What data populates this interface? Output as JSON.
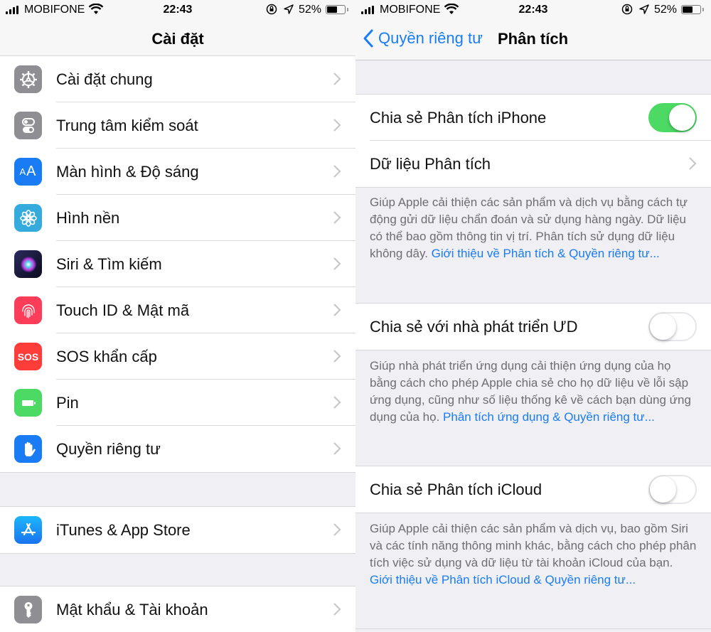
{
  "status_bar": {
    "carrier": "MOBIFONE",
    "time": "22:43",
    "battery_percent_label": "52%",
    "battery_level": 0.52
  },
  "left": {
    "title": "Cài đặt",
    "groups": [
      {
        "items": [
          {
            "label": "Cài đặt chung",
            "icon": "gear-icon",
            "color": "#8e8e93"
          },
          {
            "label": "Trung tâm kiểm soát",
            "icon": "control-center-icon",
            "color": "#8e8e93"
          },
          {
            "label": "Màn hình & Độ sáng",
            "icon": "display-brightness-icon",
            "color": "#1a7cf5"
          },
          {
            "label": "Hình nền",
            "icon": "wallpaper-flower-icon",
            "color": "#35aadc"
          },
          {
            "label": "Siri & Tìm kiếm",
            "icon": "siri-icon",
            "color": "#1c1c3c"
          },
          {
            "label": "Touch ID & Mật mã",
            "icon": "fingerprint-icon",
            "color": "#fc3d59"
          },
          {
            "label": "SOS khẩn cấp",
            "icon": "sos-icon",
            "color": "#fc3d39",
            "icon_text": "SOS"
          },
          {
            "label": "Pin",
            "icon": "battery-icon",
            "color": "#4cd964"
          },
          {
            "label": "Quyền riêng tư",
            "icon": "hand-privacy-icon",
            "color": "#1a7cf5"
          }
        ]
      },
      {
        "items": [
          {
            "label": "iTunes & App Store",
            "icon": "app-store-icon",
            "color": "#1f9bfb"
          }
        ]
      },
      {
        "items": [
          {
            "label": "Mật khẩu & Tài khoản",
            "icon": "key-icon",
            "color": "#8e8e93"
          }
        ]
      }
    ],
    "icon_text": {
      "display": "AA",
      "sos": "SOS"
    }
  },
  "right": {
    "back_label": "Quyền riêng tư",
    "title": "Phân tích",
    "sections": [
      {
        "rows": [
          {
            "label": "Chia sẻ Phân tích iPhone",
            "type": "toggle",
            "on": true
          },
          {
            "label": "Dữ liệu Phân tích",
            "type": "link"
          }
        ],
        "footer": "Giúp Apple cải thiện các sản phẩm và dịch vụ bằng cách tự động gửi dữ liệu chẩn đoán và sử dụng hàng ngày. Dữ liệu có thể bao gồm thông tin vị trí. Phân tích sử dụng dữ liệu không dây. ",
        "footer_link": "Giới thiệu về Phân tích & Quyền riêng tư..."
      },
      {
        "rows": [
          {
            "label": "Chia sẻ với nhà phát triển ƯD",
            "type": "toggle",
            "on": false
          }
        ],
        "footer": "Giúp nhà phát triển ứng dụng cải thiện ứng dụng của họ bằng cách cho phép Apple chia sẻ cho họ dữ liệu về lỗi sập ứng dụng, cũng như số liệu thống kê về cách bạn dùng ứng dụng của họ. ",
        "footer_link": "Phân tích ứng dụng & Quyền riêng tư..."
      },
      {
        "rows": [
          {
            "label": "Chia sẻ Phân tích iCloud",
            "type": "toggle",
            "on": false
          }
        ],
        "footer": "Giúp Apple cải thiện các sản phẩm và dịch vụ, bao gồm Siri và các tính năng thông minh khác, bằng cách cho phép phân tích việc sử dụng và dữ liệu từ tài khoản iCloud của bạn. ",
        "footer_link": "Giới thiệu về Phân tích iCloud & Quyền riêng tư..."
      }
    ]
  },
  "colors": {
    "accent": "#1a7cf5",
    "toggle_on": "#4cd964",
    "background": "#efeff4",
    "footer_text": "#6d6d72"
  }
}
